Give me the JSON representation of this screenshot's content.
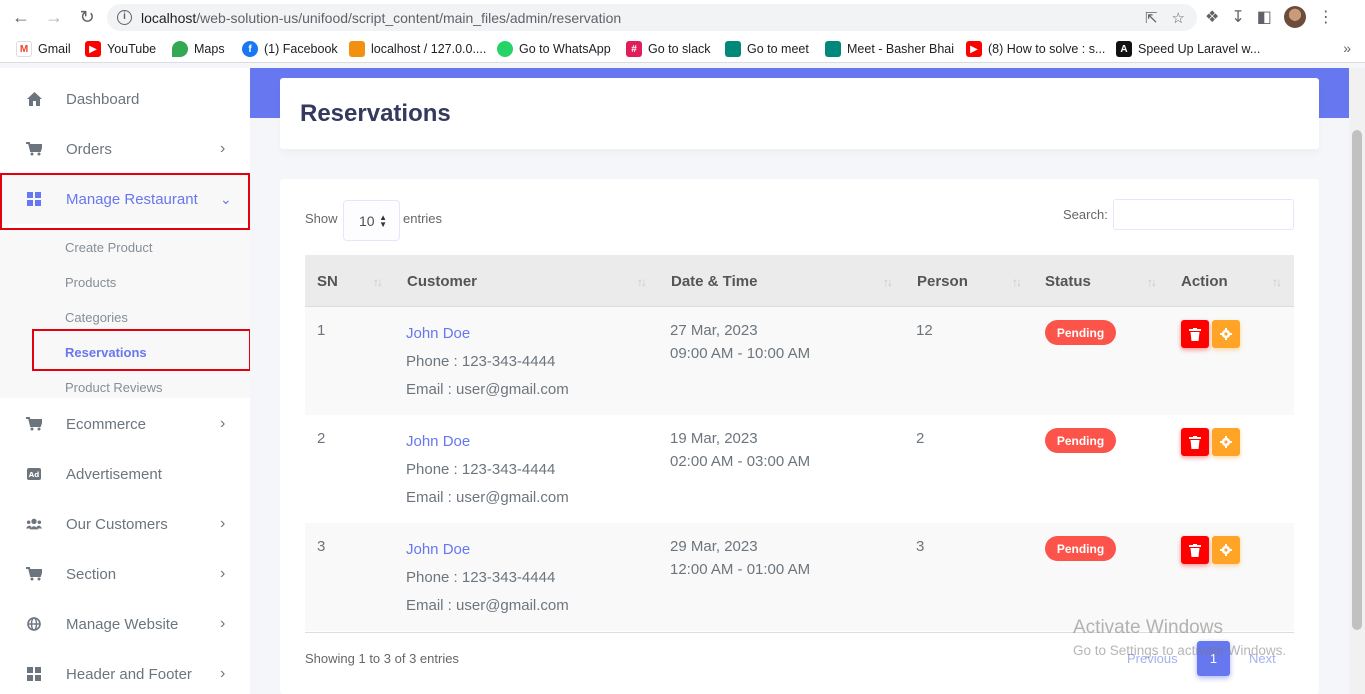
{
  "browser": {
    "url_host": "localhost",
    "url_path": "/web-solution-us/unifood/script_content/main_files/admin/reservation",
    "bookmarks": [
      {
        "label": "Gmail",
        "icon": "gmail-icon",
        "color": "#ea4335"
      },
      {
        "label": "YouTube",
        "icon": "youtube-icon",
        "color": "#ff0000"
      },
      {
        "label": "Maps",
        "icon": "maps-icon",
        "color": "#34a853"
      },
      {
        "label": "(1) Facebook",
        "icon": "facebook-icon",
        "color": "#1877f2"
      },
      {
        "label": "localhost / 127.0.0....",
        "icon": "phpmyadmin-icon",
        "color": "#f29111"
      },
      {
        "label": "Go to WhatsApp",
        "icon": "whatsapp-icon",
        "color": "#25d366"
      },
      {
        "label": "Go to slack",
        "icon": "slack-icon",
        "color": "#e01e5a"
      },
      {
        "label": "Go to meet",
        "icon": "meet-icon",
        "color": "#00897b"
      },
      {
        "label": "Meet - Basher Bhai",
        "icon": "meet-icon",
        "color": "#00897b"
      },
      {
        "label": "(8) How to solve : s...",
        "icon": "youtube-icon",
        "color": "#ff0000"
      },
      {
        "label": "Speed Up Laravel w...",
        "icon": "laravel-icon",
        "color": "#111111"
      }
    ]
  },
  "sidebar": {
    "items": [
      {
        "label": "Dashboard",
        "icon": "home-icon"
      },
      {
        "label": "Orders",
        "icon": "cart-icon"
      },
      {
        "label": "Manage Restaurant",
        "icon": "grid-icon"
      },
      {
        "label": "Ecommerce",
        "icon": "cart-icon"
      },
      {
        "label": "Advertisement",
        "icon": "ad-icon"
      },
      {
        "label": "Our Customers",
        "icon": "users-icon"
      },
      {
        "label": "Section",
        "icon": "cart-icon"
      },
      {
        "label": "Manage Website",
        "icon": "globe-icon"
      },
      {
        "label": "Header and Footer",
        "icon": "grid-icon"
      }
    ],
    "submenu": [
      "Create Product",
      "Products",
      "Categories",
      "Reservations",
      "Product Reviews"
    ]
  },
  "page": {
    "title": "Reservations"
  },
  "table": {
    "show_label": "Show",
    "length_value": "10",
    "entries_label": "entries",
    "search_label": "Search:",
    "headers": [
      "SN",
      "Customer",
      "Date & Time",
      "Person",
      "Status",
      "Action"
    ],
    "rows": [
      {
        "sn": "1",
        "name": "John Doe",
        "phone": "Phone : 123-343-4444",
        "email": "Email : user@gmail.com",
        "date": "27 Mar, 2023",
        "time": "09:00 AM - 10:00 AM",
        "person": "12",
        "status": "Pending"
      },
      {
        "sn": "2",
        "name": "John Doe",
        "phone": "Phone : 123-343-4444",
        "email": "Email : user@gmail.com",
        "date": "19 Mar, 2023",
        "time": "02:00 AM - 03:00 AM",
        "person": "2",
        "status": "Pending"
      },
      {
        "sn": "3",
        "name": "John Doe",
        "phone": "Phone : 123-343-4444",
        "email": "Email : user@gmail.com",
        "date": "29 Mar, 2023",
        "time": "12:00 AM - 01:00 AM",
        "person": "3",
        "status": "Pending"
      }
    ],
    "info": "Showing 1 to 3 of 3 entries",
    "pagination": {
      "previous": "Previous",
      "current": "1",
      "next": "Next"
    }
  },
  "watermark": {
    "line1": "Activate Windows",
    "line2": "Go to Settings to activate Windows."
  }
}
